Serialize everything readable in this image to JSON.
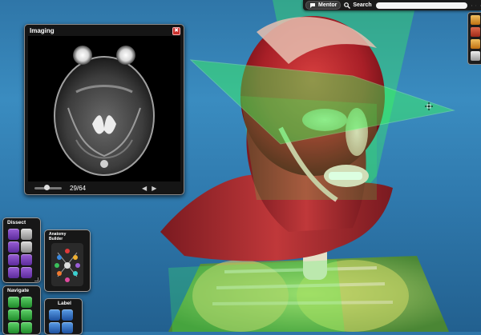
{
  "topbar": {
    "mentor_label": "Mentor",
    "search_label": "Search",
    "search_value": ""
  },
  "imaging": {
    "title": "Imaging",
    "close_glyph": "✖",
    "slice_counter": "29/64",
    "prev_glyph": "◀",
    "next_glyph": "▶"
  },
  "dissect": {
    "title": "Dissect"
  },
  "anatomy_builder": {
    "title_line1": "Anatomy",
    "title_line2": "Builder"
  },
  "navigate": {
    "title": "Navigate"
  },
  "label": {
    "title": "Label"
  },
  "colors": {
    "panel_bg": "#171717",
    "plane_green": "#3cff5a",
    "muscle_red": "#b3242a",
    "close_red": "#c9302c"
  },
  "icons": [
    "mentor-icon",
    "search-icon",
    "clear-icon",
    "settings-icon",
    "help-icon",
    "close-icon",
    "slice-slider",
    "crosshair-icon"
  ]
}
